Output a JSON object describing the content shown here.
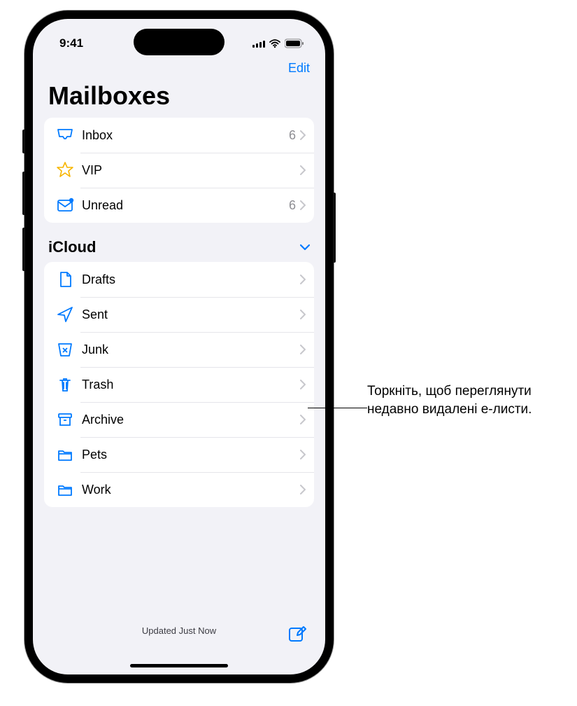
{
  "status": {
    "time": "9:41"
  },
  "nav": {
    "edit": "Edit"
  },
  "title": "Mailboxes",
  "mailboxes": [
    {
      "icon": "inbox",
      "label": "Inbox",
      "count": "6"
    },
    {
      "icon": "vip",
      "label": "VIP",
      "count": ""
    },
    {
      "icon": "unread",
      "label": "Unread",
      "count": "6"
    }
  ],
  "section": {
    "header": "iCloud"
  },
  "folders": [
    {
      "icon": "drafts",
      "label": "Drafts"
    },
    {
      "icon": "sent",
      "label": "Sent"
    },
    {
      "icon": "junk",
      "label": "Junk"
    },
    {
      "icon": "trash",
      "label": "Trash"
    },
    {
      "icon": "archive",
      "label": "Archive"
    },
    {
      "icon": "folder",
      "label": "Pets"
    },
    {
      "icon": "folder",
      "label": "Work"
    }
  ],
  "toolbar": {
    "status": "Updated Just Now"
  },
  "callout": "Торкніть, щоб переглянути недавно видалені е-листи."
}
